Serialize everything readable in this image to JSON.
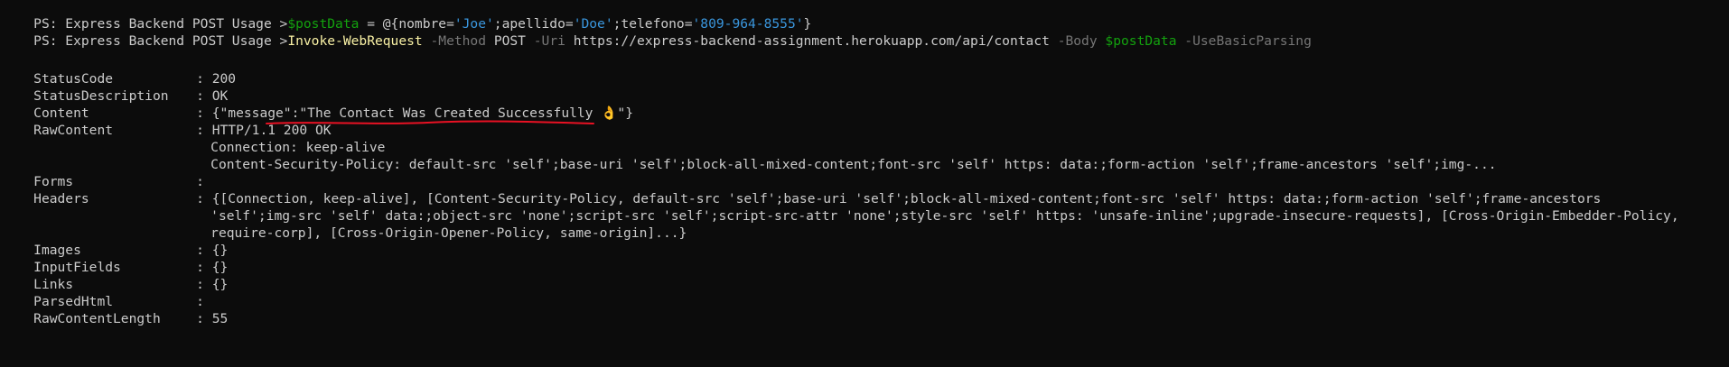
{
  "prompt": "PS: Express Backend POST Usage >",
  "line1": {
    "var": "$postData",
    "eq": " = ",
    "open": "@{",
    "k1": "nombre",
    "v1": "'Joe'",
    "k2": "apellido",
    "v2": "'Doe'",
    "k3": "telefono",
    "v3": "'809-964-8555'",
    "close": "}"
  },
  "line2": {
    "cmd": "Invoke-WebRequest",
    "p_method": "-Method",
    "method": "POST",
    "p_uri": "-Uri",
    "uri": "https://express-backend-assignment.herokuapp.com/api/contact",
    "p_body": "-Body",
    "body_var": "$postData",
    "p_basic": "-UseBasicParsing"
  },
  "output": {
    "status_code_key": "StatusCode",
    "status_code_val": "200",
    "status_desc_key": "StatusDescription",
    "status_desc_val": "OK",
    "content_key": "Content",
    "content_val": "{\"message\":\"The Contact Was Created Successfully 👌\"}",
    "raw_content_key": "RawContent",
    "raw_content_lines": [
      "HTTP/1.1 200 OK",
      "Connection: keep-alive",
      "Content-Security-Policy: default-src 'self';base-uri 'self';block-all-mixed-content;font-src 'self' https: data:;form-action 'self';frame-ancestors 'self';img-..."
    ],
    "forms_key": "Forms",
    "forms_val": "",
    "headers_key": "Headers",
    "headers_lines": [
      "{[Connection, keep-alive], [Content-Security-Policy, default-src 'self';base-uri 'self';block-all-mixed-content;font-src 'self' https: data:;form-action 'self';frame-ancestors",
      "'self';img-src 'self' data:;object-src 'none';script-src 'self';script-src-attr 'none';style-src 'self' https: 'unsafe-inline';upgrade-insecure-requests], [Cross-Origin-Embedder-Policy,",
      "require-corp], [Cross-Origin-Opener-Policy, same-origin]...}"
    ],
    "images_key": "Images",
    "images_val": "{}",
    "inputfields_key": "InputFields",
    "inputfields_val": "{}",
    "links_key": "Links",
    "links_val": "{}",
    "parsedhtml_key": "ParsedHtml",
    "parsedhtml_val": "",
    "rawcontentlength_key": "RawContentLength",
    "rawcontentlength_val": "55",
    "separator": ": "
  },
  "colors": {
    "background": "#0c0c0c",
    "text": "#cccccc",
    "variable": "#13a10e",
    "string": "#3a96dd",
    "command": "#f9f1a5",
    "parameter": "#767676",
    "annotation": "#e81123"
  },
  "annotations": {
    "underline_note": "red hand-drawn underline beneath the success message"
  }
}
